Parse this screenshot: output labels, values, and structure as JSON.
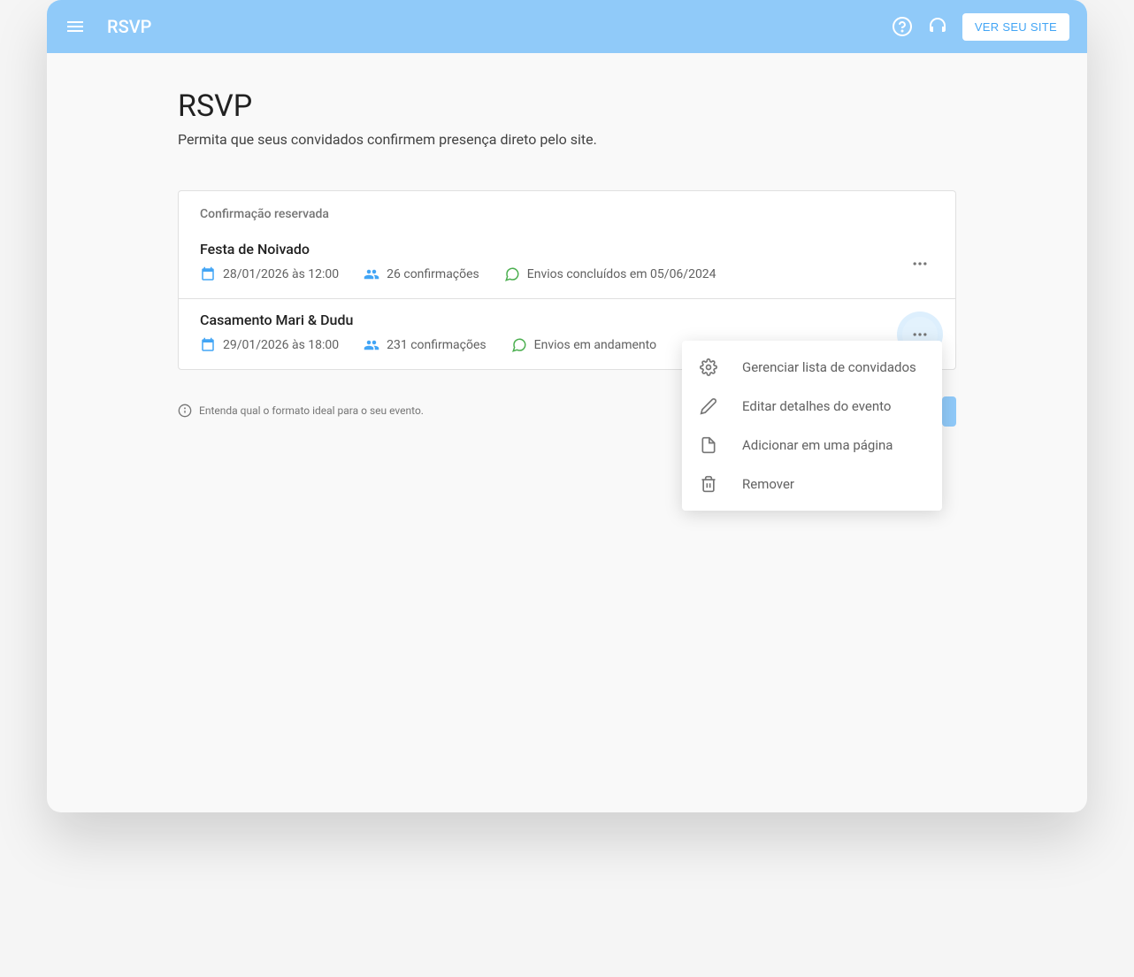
{
  "topbar": {
    "title": "RSVP",
    "ver_site_label": "VER SEU SITE"
  },
  "page": {
    "title": "RSVP",
    "subtitle": "Permita que seus convidados confirmem presença direto pelo site."
  },
  "card": {
    "header": "Confirmação reservada"
  },
  "events": [
    {
      "title": "Festa de Noivado",
      "date": "28/01/2026 às 12:00",
      "confirmations": "26 confirmações",
      "status": "Envios concluídos em 05/06/2024"
    },
    {
      "title": "Casamento Mari & Dudu",
      "date": "29/01/2026 às 18:00",
      "confirmations": "231 confirmações",
      "status": "Envios em andamento"
    }
  ],
  "footer_hint": "Entenda qual o formato ideal para o seu evento.",
  "dropdown": {
    "items": [
      {
        "label": "Gerenciar lista de convidados"
      },
      {
        "label": "Editar detalhes do evento"
      },
      {
        "label": "Adicionar em uma página"
      },
      {
        "label": "Remover"
      }
    ]
  }
}
